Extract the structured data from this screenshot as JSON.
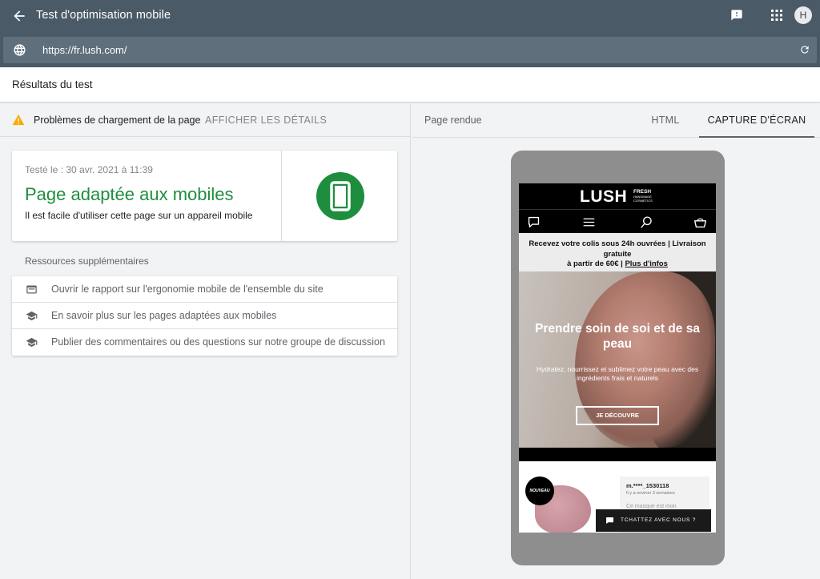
{
  "app": {
    "title": "Test d'optimisation mobile",
    "avatar_initial": "H",
    "url": "https://fr.lush.com/"
  },
  "results": {
    "title": "Résultats du test"
  },
  "issues": {
    "text": "Problèmes de chargement de la page",
    "details_link": "AFFICHER LES DÉTAILS"
  },
  "result_card": {
    "tested_date": "Testé le : 30 avr. 2021 à 11:39",
    "verdict": "Page adaptée aux mobiles",
    "description": "Il est facile d'utiliser cette page sur un appareil mobile"
  },
  "resources": {
    "title": "Ressources supplémentaires",
    "items": [
      {
        "icon": "web-report-icon",
        "label": "Ouvrir le rapport sur l'ergonomie mobile de l'ensemble du site"
      },
      {
        "icon": "school-icon",
        "label": "En savoir plus sur les pages adaptées aux mobiles"
      },
      {
        "icon": "school-icon",
        "label": "Publier des commentaires ou des questions sur notre groupe de discussion"
      }
    ]
  },
  "right_panel": {
    "rendered_label": "Page rendue",
    "tabs": [
      {
        "label": "HTML",
        "active": false
      },
      {
        "label": "CAPTURE D'ÉCRAN",
        "active": true
      }
    ]
  },
  "screenshot": {
    "logo": "LUSH",
    "logo_fresh": "FRESH",
    "logo_sub": "HANDMADE COSMETICS",
    "promo_line1": "Recevez votre colis sous 24h ouvrées | Livraison gratuite",
    "promo_line2": "à partir de 60€ | ",
    "promo_link": "Plus d'infos",
    "hero_title": "Prendre soin de soi et de sa peau",
    "hero_subtitle": "Hydratez, nourrissez et sublimez votre peau avec des ingrédients frais et naturels",
    "hero_button": "JE DÉCOUVRE",
    "badge": "NOUVEAU",
    "review_user": "m.****_1530118",
    "review_time": "Il y a environ 3 semaines",
    "review_snippet": "Ce masque est mon",
    "chat_button": "TCHATTEZ AVEC NOUS ?"
  },
  "colors": {
    "topbar": "#4a5a67",
    "success_green": "#1e8e3e",
    "warning_yellow": "#f9ab00"
  }
}
